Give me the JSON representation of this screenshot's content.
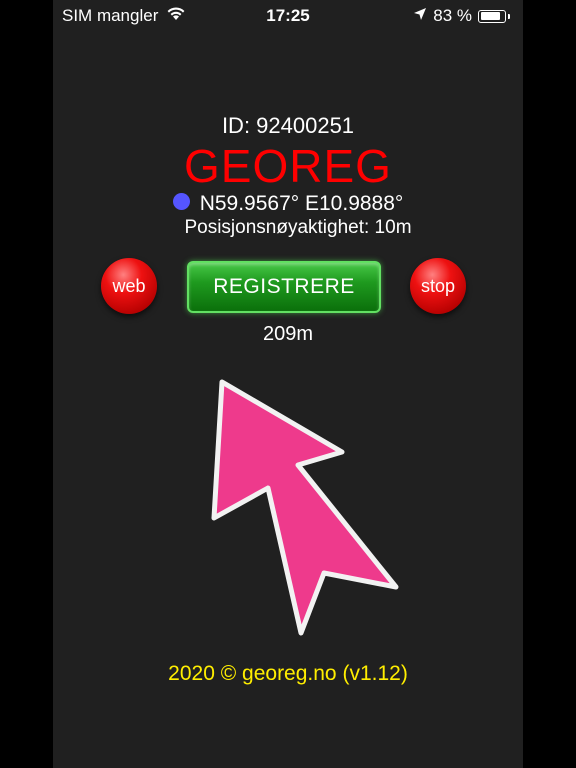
{
  "status_bar": {
    "carrier": "SIM mangler",
    "time": "17:25",
    "battery_percent": "83 %",
    "battery_level": 0.83,
    "icons": [
      "wifi-icon",
      "location-arrow-icon",
      "battery-icon"
    ]
  },
  "app": {
    "id_text": "ID: 92400251",
    "title": "GEOREG",
    "coordinates": "N59.9567° E10.9888°",
    "accuracy": "Posisjonsnøyaktighet: 10m",
    "distance": "209m",
    "footer": "2020 © georeg.no (v1.12)"
  },
  "buttons": {
    "web": "web",
    "register": "REGISTRERE",
    "stop": "stop"
  },
  "colors": {
    "background": "#202020",
    "title": "#ff0000",
    "footer": "#ffee00",
    "gps_dot": "#5555ff",
    "arrow": "#ee3a8c",
    "register_button": "#1f9a1f"
  }
}
